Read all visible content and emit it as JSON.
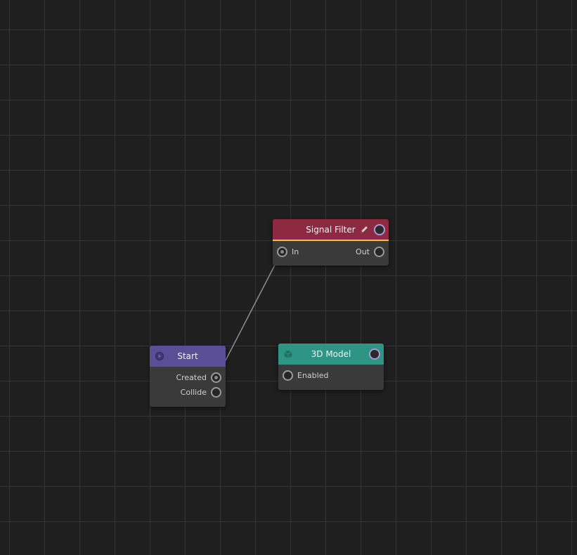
{
  "canvas": {
    "nodes": {
      "signal_filter": {
        "title": "Signal Filter",
        "header_color": "#8d2a42",
        "accent_color": "#f0c43c",
        "header_icon": "pencil-icon",
        "inputs": [
          "In"
        ],
        "outputs": [
          "Out"
        ]
      },
      "start": {
        "title": "Start",
        "header_color": "#5a4e96",
        "header_icon": "play-icon",
        "outputs": [
          "Created",
          "Collide"
        ]
      },
      "model_3d": {
        "title": "3D Model",
        "header_color": "#2e9483",
        "header_icon": "cube-icon",
        "inputs": [
          "Enabled"
        ]
      }
    },
    "connections": [
      {
        "from": "Start.Created",
        "to": "Signal Filter.In"
      }
    ]
  }
}
